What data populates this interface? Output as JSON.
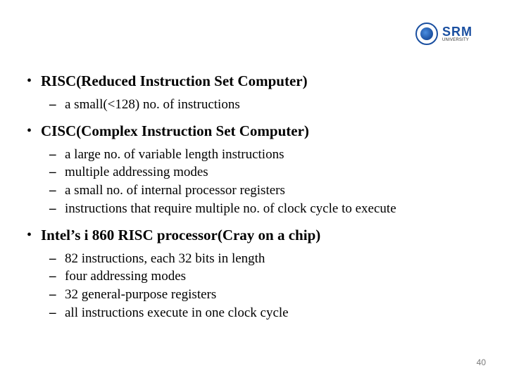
{
  "logo": {
    "main": "SRM",
    "sub": "UNIVERSITY"
  },
  "bullets": [
    {
      "head": "RISC(Reduced Instruction Set Computer)",
      "subs": [
        "a small(<128) no. of instructions"
      ]
    },
    {
      "head": "CISC(Complex Instruction Set Computer)",
      "subs": [
        "a large no. of variable length instructions",
        "multiple addressing modes",
        "a small no. of internal processor registers",
        "instructions that require multiple no. of clock cycle to execute"
      ]
    },
    {
      "head": "Intel’s i 860 RISC processor(Cray on a chip)",
      "subs": [
        "82 instructions, each 32 bits in length",
        "four addressing modes",
        "32 general-purpose registers",
        "all instructions execute in one clock cycle"
      ]
    }
  ],
  "page_number": "40"
}
